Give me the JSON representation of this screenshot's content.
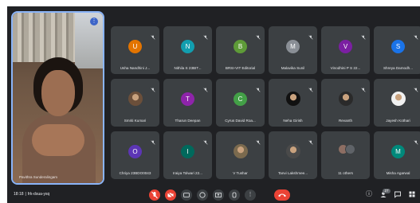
{
  "speaker": {
    "name": "Pavithra Sunderalingam"
  },
  "participants": [
    {
      "name": "Usha Nandhini J...",
      "initial": "U",
      "color": "#e37400",
      "kind": "avatar"
    },
    {
      "name": "Nithila S 23BIT...",
      "initial": "N",
      "color": "#129eaf",
      "kind": "avatar"
    },
    {
      "name": "BRSI-VIT Editorial",
      "initial": "B",
      "color": "#5e9b38",
      "kind": "avatar"
    },
    {
      "name": "Malavika Sunil",
      "initial": "M",
      "color": "#8a8f96",
      "kind": "avatar"
    },
    {
      "name": "Vinodhini P S 22...",
      "initial": "V",
      "color": "#7b1fa2",
      "kind": "avatar"
    },
    {
      "name": "Shreya Damodh...",
      "initial": "S",
      "color": "#1a73e8",
      "kind": "avatar"
    },
    {
      "name": "Smriti Kumari",
      "initial": "",
      "color": "#6b4f3a",
      "kind": "photo"
    },
    {
      "name": "Tharun Deepan",
      "initial": "T",
      "color": "#8e24aa",
      "kind": "avatar"
    },
    {
      "name": "Cyrus David Roa...",
      "initial": "C",
      "color": "#43a047",
      "kind": "avatar"
    },
    {
      "name": "Neha Girish",
      "initial": "",
      "color": "#111111",
      "kind": "photo"
    },
    {
      "name": "Revanth",
      "initial": "",
      "color": "#2a2a2a",
      "kind": "photo"
    },
    {
      "name": "Jayesh Kothari",
      "initial": "",
      "color": "#f1f1f1",
      "kind": "photo"
    },
    {
      "name": "Chriya 23BDO0043",
      "initial": "O",
      "color": "#5c35b5",
      "kind": "avatar"
    },
    {
      "name": "Iraiya Tolwari 22...",
      "initial": "I",
      "color": "#00695c",
      "kind": "avatar"
    },
    {
      "name": "V Tushar",
      "initial": "",
      "color": "#7b6a4e",
      "kind": "photo"
    },
    {
      "name": "Tanvi Lakshmee...",
      "initial": "",
      "color": "#4a4a4a",
      "kind": "photo"
    },
    {
      "name": "11 others",
      "initial": "",
      "color": "#5f6368",
      "kind": "others"
    },
    {
      "name": "Misha Agarwal",
      "initial": "M",
      "color": "#00897b",
      "kind": "avatar"
    }
  ],
  "meeting": {
    "time": "18:18",
    "code": "frk-dsua-ysq"
  },
  "controls": [
    "mic-off",
    "camera-off",
    "captions",
    "emoji",
    "present",
    "raise-hand",
    "more",
    "end-call"
  ],
  "right_controls": {
    "people_count": "27"
  }
}
